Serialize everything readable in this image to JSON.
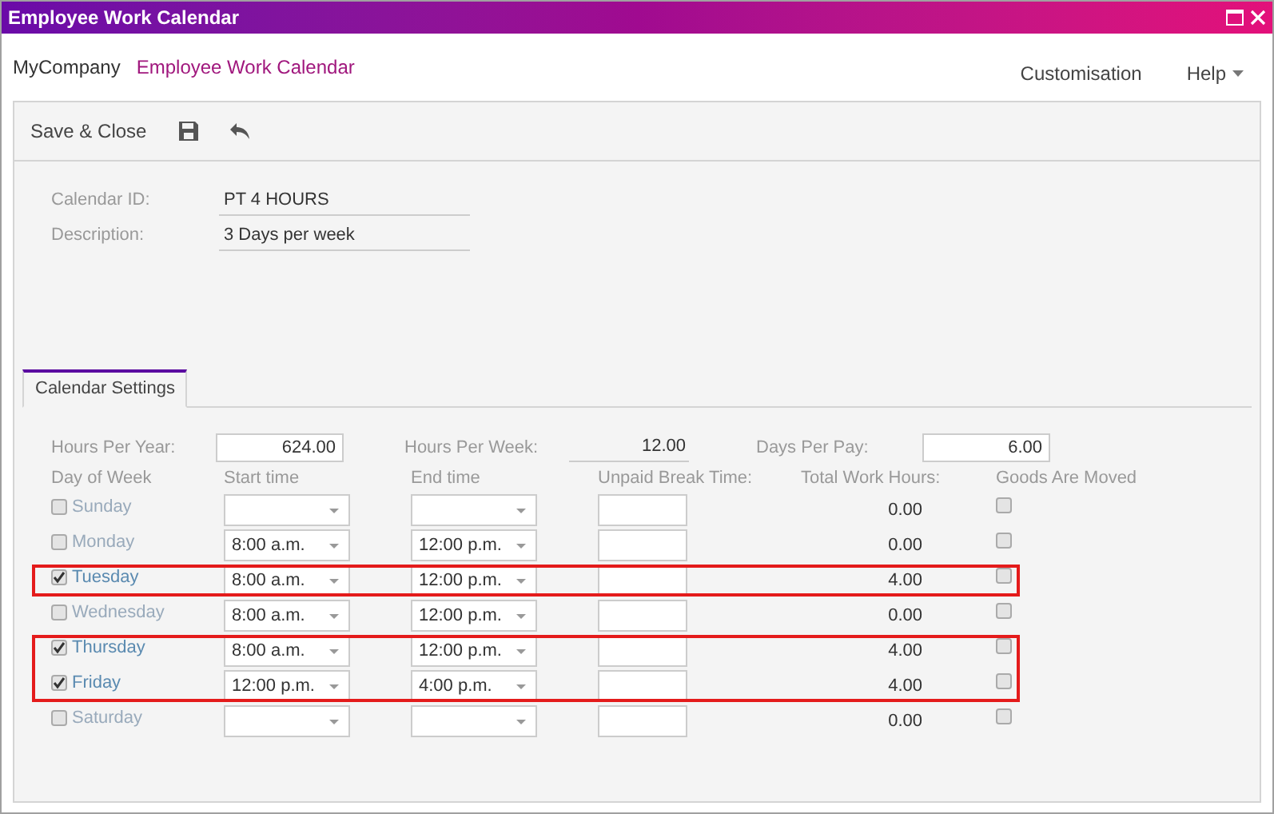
{
  "window": {
    "title": "Employee Work Calendar"
  },
  "breadcrumb": {
    "company": "MyCompany",
    "page": "Employee Work Calendar"
  },
  "top_menu": [
    {
      "label": "Customisation",
      "has_dropdown": false
    },
    {
      "label": "Help",
      "has_dropdown": true
    }
  ],
  "toolbar": {
    "save_close": "Save & Close"
  },
  "fields": [
    {
      "label": "Calendar ID:",
      "value": "PT 4 HOURS"
    },
    {
      "label": "Description:",
      "value": "3 Days per week"
    }
  ],
  "tabs": [
    {
      "label": "Calendar Settings",
      "selected": true
    }
  ],
  "summary": {
    "hours_per_year_label": "Hours Per Year:",
    "hours_per_year": "624.00",
    "hours_per_week_label": "Hours Per Week:",
    "hours_per_week": "12.00",
    "days_per_pay_label": "Days Per Pay:",
    "days_per_pay": "6.00"
  },
  "columns": [
    "Day of Week",
    "Start time",
    "End time",
    "Unpaid Break Time:",
    "Total Work Hours:",
    "Goods Are Moved"
  ],
  "days": [
    {
      "day": "Sunday",
      "checked": false,
      "total": "0.00",
      "goods_moved": false,
      "highlighted": false
    },
    {
      "day": "Monday",
      "checked": false,
      "start": "8:00 a.m.",
      "end": "12:00 p.m.",
      "total": "0.00",
      "goods_moved": false,
      "highlighted": false
    },
    {
      "day": "Tuesday",
      "checked": true,
      "start": "8:00 a.m.",
      "end": "12:00 p.m.",
      "total": "4.00",
      "goods_moved": false,
      "highlighted": true
    },
    {
      "day": "Wednesday",
      "checked": false,
      "start": "8:00 a.m.",
      "end": "12:00 p.m.",
      "total": "0.00",
      "goods_moved": false,
      "highlighted": false
    },
    {
      "day": "Thursday",
      "checked": true,
      "start": "8:00 a.m.",
      "end": "12:00 p.m.",
      "total": "4.00",
      "goods_moved": false,
      "highlighted": true
    },
    {
      "day": "Friday",
      "checked": true,
      "start": "12:00 p.m.",
      "end": "4:00 p.m.",
      "total": "4.00",
      "goods_moved": false,
      "highlighted": true
    },
    {
      "day": "Saturday",
      "checked": false,
      "total": "0.00",
      "goods_moved": false,
      "highlighted": false
    }
  ]
}
